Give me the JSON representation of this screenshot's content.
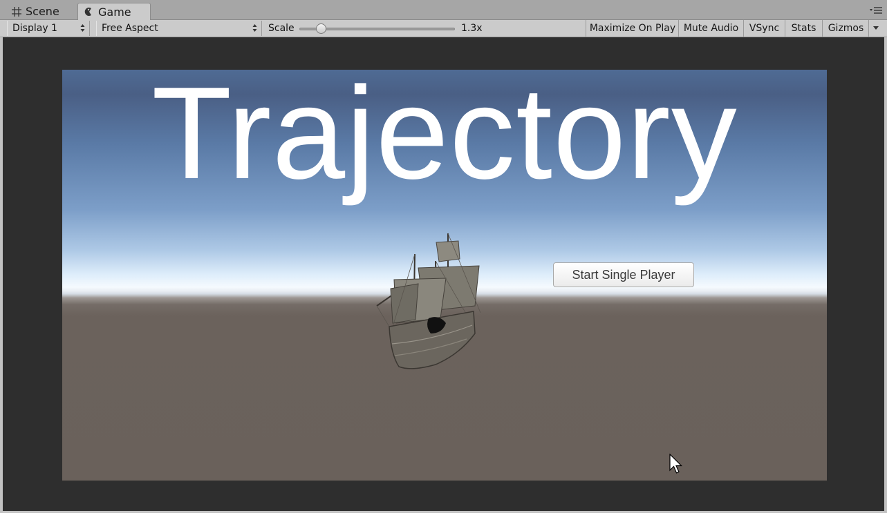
{
  "tabs": [
    {
      "label": "Scene",
      "icon": "grid-icon"
    },
    {
      "label": "Game",
      "icon": "game-controller-icon"
    }
  ],
  "toolbar": {
    "display": "Display 1",
    "aspect": "Free Aspect",
    "scale_label": "Scale",
    "scale_value": "1.3x",
    "scale_fraction": 0.1,
    "buttons": {
      "maximize": "Maximize On Play",
      "mute": "Mute Audio",
      "vsync": "VSync",
      "stats": "Stats",
      "gizmos": "Gizmos"
    }
  },
  "game": {
    "title": "Trajectory",
    "start_button": "Start Single Player",
    "ship_icon": "sailing-ship-icon"
  },
  "colors": {
    "sky_top": "#4a5f85",
    "ground": "#6a615b",
    "game_background": "#2e2e2e"
  }
}
